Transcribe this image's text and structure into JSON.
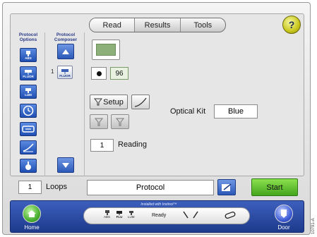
{
  "tabs": {
    "read": "Read",
    "results": "Results",
    "tools": "Tools"
  },
  "help": {
    "label": "?"
  },
  "protocol_options": {
    "title": "Protocol Options",
    "buttons": [
      {
        "icon": "absorbance-icon",
        "label": "ABS"
      },
      {
        "icon": "fluorescence-icon",
        "label": "FLUOR"
      },
      {
        "icon": "luminescence-icon",
        "label": "LUM"
      },
      {
        "icon": "clock-icon",
        "label": ""
      },
      {
        "icon": "shake-icon",
        "label": ""
      },
      {
        "icon": "kinetic-icon",
        "label": ""
      },
      {
        "icon": "injector-icon",
        "label": ""
      }
    ]
  },
  "protocol_composer": {
    "title": "Protocol Composer",
    "items": [
      {
        "number": "1",
        "label": "FLUOR"
      }
    ]
  },
  "read": {
    "plate_format": "96",
    "setup_label": "Setup",
    "reading_value": "1",
    "reading_label": "Reading",
    "optical_kit_label": "Optical Kit",
    "optical_kit_value": "Blue"
  },
  "footer": {
    "loops_value": "1",
    "loops_label": "Loops",
    "protocol_value": "Protocol",
    "start_label": "Start"
  },
  "status_bar": {
    "installed_text": "Installed with Instinct™",
    "modes": [
      "ABS",
      "FLU",
      "LUM"
    ],
    "status": "Ready",
    "home_label": "Home",
    "door_label": "Door"
  },
  "figure_code": "10791-A",
  "colors": {
    "accent_blue": "#2b59b8",
    "start_green": "#44a51d",
    "help_yellow": "#c9c71d",
    "swatch_green": "#8db07a"
  }
}
